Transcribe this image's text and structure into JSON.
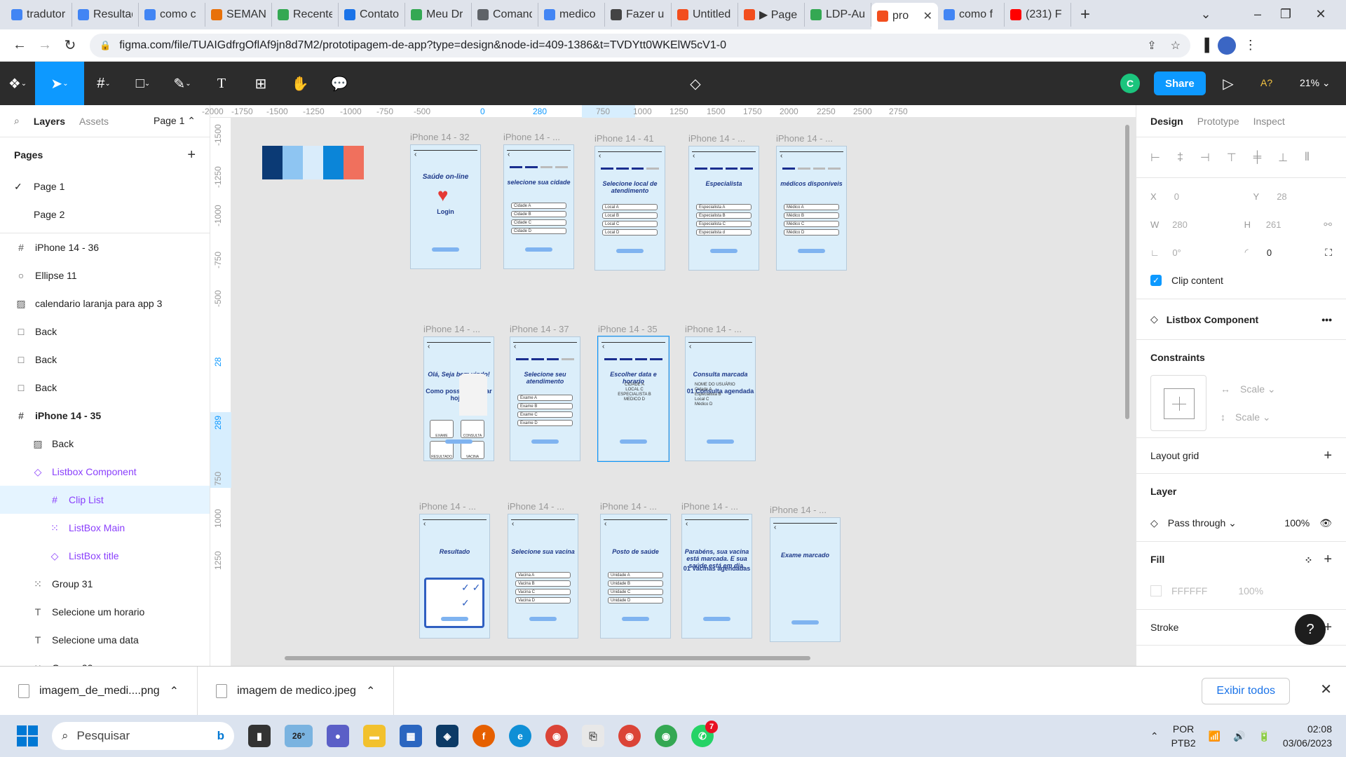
{
  "browser": {
    "tabs": [
      {
        "title": "tradutor",
        "favicon": "google-icon",
        "color": "#4285f4"
      },
      {
        "title": "Resultados",
        "favicon": "google-icon",
        "color": "#4285f4"
      },
      {
        "title": "como c",
        "favicon": "google-icon",
        "color": "#4285f4"
      },
      {
        "title": "SEMANA",
        "favicon": "orange-app-icon",
        "color": "#e8710a"
      },
      {
        "title": "Recente",
        "favicon": "drive-icon",
        "color": "#34a853"
      },
      {
        "title": "Contato",
        "favicon": "contacts-icon",
        "color": "#1a73e8"
      },
      {
        "title": "Meu Dr",
        "favicon": "drive-icon",
        "color": "#34a853"
      },
      {
        "title": "Comand",
        "favicon": "doc-icon",
        "color": "#5f6368"
      },
      {
        "title": "medico",
        "favicon": "google-icon",
        "color": "#4285f4"
      },
      {
        "title": "Fazer u",
        "favicon": "layers-icon",
        "color": "#444444"
      },
      {
        "title": "Untitled",
        "favicon": "figma-icon",
        "color": "#f24e1e"
      },
      {
        "title": "▶ Page",
        "favicon": "figma-icon",
        "color": "#f24e1e"
      },
      {
        "title": "LDP-Au",
        "favicon": "drive-icon",
        "color": "#34a853"
      },
      {
        "title": "pro",
        "favicon": "figma-icon",
        "color": "#f24e1e",
        "active": true
      },
      {
        "title": "como f",
        "favicon": "google-icon",
        "color": "#4285f4"
      },
      {
        "title": "(231) F",
        "favicon": "youtube-icon",
        "color": "#ff0000"
      }
    ],
    "url": "figma.com/file/TUAIGdfrgOflAf9jn8d7M2/prototipagem-de-app?type=design&node-id=409-1386&t=TVDYtt0WKElW5cV1-0"
  },
  "toolbar": {
    "avatar_letter": "C",
    "share_label": "Share",
    "ai_label": "A?",
    "zoom": "21%"
  },
  "left_panel": {
    "tab_layers": "Layers",
    "tab_assets": "Assets",
    "page_selector": "Page 1",
    "pages_heading": "Pages",
    "pages": [
      "Page 1",
      "Page 2"
    ],
    "layers": [
      {
        "name": "iPhone 14 - 36",
        "icon": "frame-icon",
        "indent": 0,
        "kind": "frame"
      },
      {
        "name": "Ellipse 11",
        "icon": "ellipse-icon",
        "indent": 0,
        "kind": "shape"
      },
      {
        "name": "calendario laranja para app 3",
        "icon": "image-icon",
        "indent": 0,
        "kind": "image"
      },
      {
        "name": "Back",
        "icon": "rectangle-icon",
        "indent": 0,
        "kind": "shape"
      },
      {
        "name": "Back",
        "icon": "rectangle-icon",
        "indent": 0,
        "kind": "shape"
      },
      {
        "name": "Back",
        "icon": "rectangle-icon",
        "indent": 0,
        "kind": "shape"
      },
      {
        "name": "iPhone 14 - 35",
        "icon": "frame-icon",
        "indent": 0,
        "kind": "frame",
        "bold": true
      },
      {
        "name": "Back",
        "icon": "image-icon",
        "indent": 1,
        "kind": "image"
      },
      {
        "name": "Listbox Component",
        "icon": "instance-icon",
        "indent": 1,
        "kind": "component"
      },
      {
        "name": "Clip List",
        "icon": "frame-icon",
        "indent": 2,
        "kind": "component",
        "selected": true
      },
      {
        "name": "ListBox Main",
        "icon": "group-icon",
        "indent": 2,
        "kind": "component"
      },
      {
        "name": "ListBox title",
        "icon": "instance-icon",
        "indent": 2,
        "kind": "component"
      },
      {
        "name": "Group 31",
        "icon": "group-icon",
        "indent": 1,
        "kind": "group"
      },
      {
        "name": "Selecione um horario",
        "icon": "text-icon",
        "indent": 1,
        "kind": "text"
      },
      {
        "name": "Selecione uma data",
        "icon": "text-icon",
        "indent": 1,
        "kind": "text"
      },
      {
        "name": "Group 22",
        "icon": "group-icon",
        "indent": 1,
        "kind": "group"
      }
    ]
  },
  "rulers": {
    "h_ticks": [
      "-2000",
      "-1750",
      "-1500",
      "-1250",
      "-1000",
      "-750",
      "-500",
      "0",
      "280",
      "750",
      "1000",
      "1250",
      "1500",
      "1750",
      "2000",
      "2250",
      "2500",
      "2750"
    ],
    "v_ticks": [
      "-1500",
      "-1250",
      "-1000",
      "-750",
      "-500",
      "28",
      "289",
      "750",
      "1000",
      "1250"
    ]
  },
  "canvas": {
    "palette": [
      "#0b3a75",
      "#8ec5f2",
      "#d9ecfb",
      "#0b85d8",
      "#f0705d"
    ],
    "frames": [
      {
        "label": "iPhone 14 - 32",
        "title": "Saúde on-line",
        "subtitle": "Login"
      },
      {
        "label": "iPhone 14 - ...",
        "title": "selecione sua cidade",
        "options": [
          "Cidade A",
          "Cidade B",
          "Cidade C",
          "Cidade D"
        ]
      },
      {
        "label": "iPhone 14 - 41",
        "title": "Selecione local de atendimento",
        "options": [
          "Local A",
          "Local B",
          "Local C",
          "Local D"
        ]
      },
      {
        "label": "iPhone 14 - ...",
        "title": "Especialista",
        "options": [
          "Especialista A",
          "Especialista B",
          "Especialista C",
          "Especialista d"
        ]
      },
      {
        "label": "iPhone 14 - ...",
        "title": "médicos disponíveis",
        "options": [
          "Médico A",
          "Médico B",
          "Médico C",
          "Médico D"
        ]
      },
      {
        "label": "iPhone 14 - ...",
        "title": "Olá, Seja bem vindo!",
        "subtitle": "Como posso te ajudar hoje?",
        "options": [
          "EXAME",
          "CONSULTA",
          "RESULTADO",
          "VACINA"
        ]
      },
      {
        "label": "iPhone 14 - 37",
        "title": "Selecione seu atendimento",
        "options": [
          "Exame A",
          "Exame B",
          "Exame C",
          "Exame D"
        ]
      },
      {
        "label": "iPhone 14 - 35",
        "title": "Escolher data e horario",
        "options": [
          "CIDADE A",
          "LOCAL C",
          "ESPECIALISTA B",
          "MEDICO D"
        ]
      },
      {
        "label": "iPhone 14 - ...",
        "title": "Consulta marcada",
        "subtitle": "01 Consulta agendada",
        "options": [
          "NOME DO USUÁRIO",
          "Cidade A",
          "Especialista B",
          "Local C",
          "Médico D"
        ]
      },
      {
        "label": "iPhone 14 - ...",
        "title": "Resultado"
      },
      {
        "label": "iPhone 14 - ...",
        "title": "Selecione sua vacina",
        "options": [
          "Vacina A",
          "Vacina B",
          "Vacina C",
          "Vacina D"
        ]
      },
      {
        "label": "iPhone 14 - ...",
        "title": "Posto de saúde",
        "options": [
          "Unidade A",
          "Unidade B",
          "Unidade C",
          "Unidade D"
        ]
      },
      {
        "label": "iPhone 14 - ...",
        "title": "Parabéns, sua vacina está marcada. E sua saúde está em dia.",
        "subtitle": "01 Vacinas agendadas"
      },
      {
        "label": "iPhone 14 - ...",
        "title": "Exame marcado"
      }
    ]
  },
  "right_panel": {
    "tabs": [
      "Design",
      "Prototype",
      "Inspect"
    ],
    "x_label": "X",
    "x_value": "0",
    "y_label": "Y",
    "y_value": "28",
    "w_label": "W",
    "w_value": "280",
    "h_label": "H",
    "h_value": "261",
    "rotation": "0°",
    "radius": "0",
    "clip_content": "Clip content",
    "component_name": "Listbox Component",
    "constraints_heading": "Constraints",
    "constraint_h": "Scale",
    "constraint_v": "Scale",
    "layout_grid": "Layout grid",
    "layer_heading": "Layer",
    "blend_mode": "Pass through",
    "layer_opacity": "100%",
    "fill_heading": "Fill",
    "fill_hex": "FFFFFF",
    "fill_opacity": "100%",
    "stroke_heading": "Stroke",
    "help": "?"
  },
  "downloads": {
    "items": [
      "imagem_de_medi....png",
      "imagem de medico.jpeg"
    ],
    "show_all": "Exibir todos"
  },
  "taskbar": {
    "search_placeholder": "Pesquisar",
    "weather": "26°",
    "whatsapp_badge": "7",
    "lang_top": "POR",
    "lang_bottom": "PTB2",
    "time": "02:08",
    "date": "03/06/2023"
  }
}
